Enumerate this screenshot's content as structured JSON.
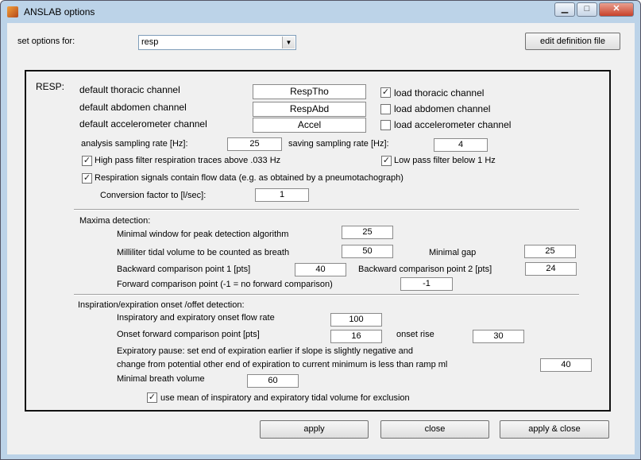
{
  "window": {
    "title": "ANSLAB options",
    "minimize_glyph": "▁",
    "maximize_glyph": "□",
    "close_glyph": "✕"
  },
  "top": {
    "set_options_label": "set options for:",
    "select_value": "resp",
    "select_arrow": "▼",
    "edit_button": "edit definition file"
  },
  "resp": {
    "section_label": "RESP:",
    "thoracic_label": "default thoracic channel",
    "thoracic_value": "RespTho",
    "abdomen_label": "default abdomen channel",
    "abdomen_value": "RespAbd",
    "accel_label": "default accelerometer channel",
    "accel_value": "Accel",
    "load_thoracic": "load thoracic channel",
    "load_abdomen": "load abdomen channel",
    "load_accel": "load accelerometer channel",
    "analysis_rate_label": "analysis sampling rate [Hz]:",
    "analysis_rate_value": "25",
    "saving_rate_label": "saving sampling rate [Hz]:",
    "saving_rate_value": "4",
    "high_pass_label": "High pass filter respiration traces above .033 Hz",
    "low_pass_label": "Low pass filter below 1 Hz",
    "flow_label": "Respiration signals contain flow data (e.g. as obtained by a pneumotachograph)",
    "conversion_label": "Conversion factor to [l/sec]:",
    "conversion_value": "1"
  },
  "maxima": {
    "heading": "Maxima detection:",
    "min_window_label": "Minimal window for peak detection algorithm",
    "min_window_value": "25",
    "tidal_label": "Milliliter tidal volume to be counted as breath",
    "tidal_value": "50",
    "min_gap_label": "Minimal gap",
    "min_gap_value": "25",
    "back1_label": "Backward comparison point 1 [pts]",
    "back1_value": "40",
    "back2_label": "Backward comparison point 2 [pts]",
    "back2_value": "24",
    "forward_label": "Forward comparison point (-1 = no forward comparison)",
    "forward_value": "-1"
  },
  "onset": {
    "heading": "Inspiration/expiration onset /offet detection:",
    "flow_rate_label": "Inspiratory and expiratory onset flow rate",
    "flow_rate_value": "100",
    "forward_label": "Onset forward comparison point [pts]",
    "forward_value": "16",
    "rise_label": "onset rise",
    "rise_value": "30",
    "pause_line1": "Expiratory pause: set end of expiration earlier if slope is slightly negative and",
    "pause_line2": "change from potential other end  of expiration to current minimum is less than ramp ml",
    "pause_value": "40",
    "min_breath_label": "Minimal breath volume",
    "min_breath_value": "60",
    "use_mean_label": "use mean of inspiratory and expiratory tidal volume for exclusion"
  },
  "buttons": {
    "apply": "apply",
    "close": "close",
    "apply_close": "apply & close"
  },
  "check_glyph": "✓"
}
